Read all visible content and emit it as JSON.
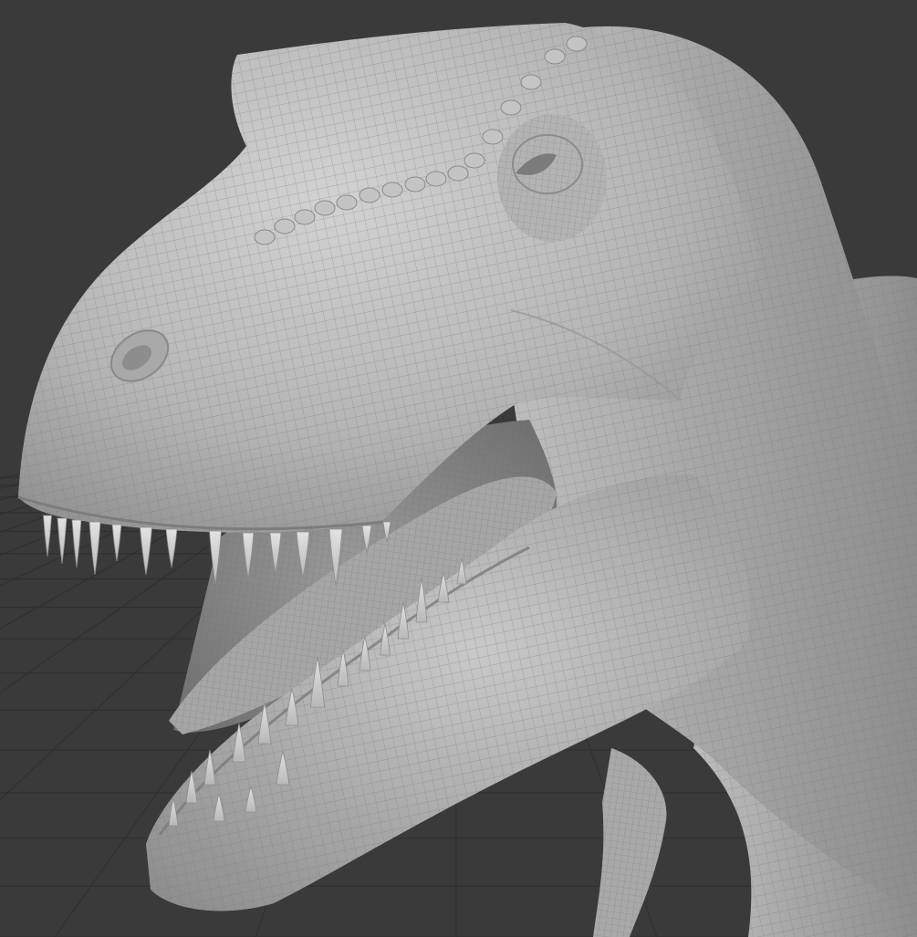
{
  "viewport": {
    "background_color": "#3a3a3a",
    "grid_color": "#2f2f2f",
    "grid_visible": true
  },
  "model": {
    "subject": "tyrannosaurus-head-sculpt",
    "display_mode": "wireframe-on-shaded",
    "mesh_base_color": "#b9b9b9",
    "wire_color": "#6f6f6f",
    "mouth_interior_color": "#8a8a8a",
    "tooth_color": "#d4d4d4"
  }
}
